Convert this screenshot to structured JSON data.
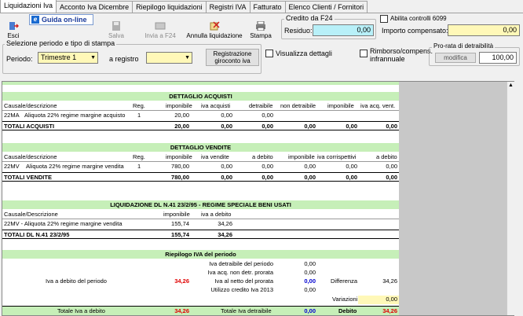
{
  "tabs": [
    "Liquidazioni Iva",
    "Acconto Iva Dicembre",
    "Riepilogo liquidazioni",
    "Registri IVA",
    "Fatturato",
    "Elenco Clienti / Fornitori"
  ],
  "toolbar": {
    "esci": "Esci",
    "guida": "Guida on-line",
    "salva": "Salva",
    "invia": "Invia a F24",
    "annulla": "Annulla liquidazione",
    "stampa": "Stampa"
  },
  "credito": {
    "title": "Credito da F24",
    "residuo_label": "Residuo:",
    "residuo_value": "0,00",
    "abilita": "Abilita controlli 6099",
    "importo_label": "Importo compensato:",
    "importo_value": "0,00"
  },
  "selezione": {
    "title": "Selezione periodo e tipo di stampa",
    "periodo_label": "Periodo:",
    "periodo_value": "Trimestre 1",
    "registro_label": "a registro",
    "registrazione": "Registrazione giroconto iva",
    "visualizza": "Visualizza dettagli",
    "rimborso": "Rimborso/compens. infrannuale",
    "prorata_title": "Pro-rata di detraibilità",
    "modifica": "modifica",
    "prorata_value": "100,00"
  },
  "acquisti": {
    "title": "DETTAGLIO ACQUISTI",
    "headers": [
      "Causale/descrizione",
      "Reg.",
      "imponibile",
      "iva acquisti",
      "detraibile",
      "non detraibile",
      "imponibile",
      "iva acq. vent."
    ],
    "row": [
      "22MA",
      "Aliquota 22% regime margine acquisto",
      "1",
      "20,00",
      "0,00",
      "0,00"
    ],
    "total": [
      "TOTALI ACQUISTI",
      "20,00",
      "0,00",
      "0,00",
      "0,00",
      "0,00",
      "0,00"
    ]
  },
  "vendite": {
    "title": "DETTAGLIO VENDITE",
    "headers": [
      "Causale/descrizione",
      "Reg.",
      "imponibile",
      "iva vendite",
      "a debito",
      "imponibile",
      "iva corrispettivi",
      "a debito"
    ],
    "row": [
      "22MV",
      "Aliquota 22% regime margine vendita",
      "1",
      "780,00",
      "0,00",
      "0,00",
      "0,00",
      "0,00",
      "0,00"
    ],
    "total": [
      "TOTALI VENDITE",
      "780,00",
      "0,00",
      "0,00",
      "0,00",
      "0,00",
      "0,00"
    ]
  },
  "dl41": {
    "title": "LIQUIDAZIONE DL N.41 23/2/95 - REGIME SPECIALE BENI USATI",
    "headers": [
      "Causale/Descrizione",
      "imponibile",
      "iva a debito"
    ],
    "row": [
      "22MV - Aliquota 22% regime margine vendita",
      "155,74",
      "34,26"
    ],
    "total": [
      "TOTALI DL N.41 23/2/95",
      "155,74",
      "34,26"
    ]
  },
  "riepilogo": {
    "title": "Riepilogo IVA del periodo",
    "detraibile_label": "Iva detraibile del periodo",
    "detraibile": "0,00",
    "nondetr_label": "Iva acq. non detr. prorata",
    "nondetr": "0,00",
    "debito_label": "Iva a debito del periodo",
    "debito": "34,26",
    "netto_label": "Iva al netto del prorata",
    "netto": "0,00",
    "diff_label": "Differenza",
    "diff": "34,26",
    "credito_label": "Utilizzo credito Iva 2013",
    "credito": "0,00",
    "variazioni_label": "Variazioni",
    "variazioni": "0,00",
    "tot_debito_label": "Totale Iva a debito",
    "tot_debito": "34,26",
    "tot_detr_label": "Totale Iva detraibile",
    "tot_detr": "0,00",
    "debito_final_label": "Debito",
    "debito_final": "34,26"
  }
}
